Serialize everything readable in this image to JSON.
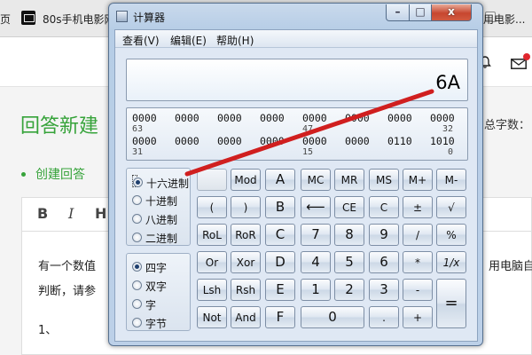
{
  "browser": {
    "tab_partial": "页",
    "tab_title": "80s手机电影网",
    "tab_right": "用电影..."
  },
  "page": {
    "answer_title": "回答新建",
    "word_count_label": "总字数：",
    "create_answer": "创建回答",
    "toolbar": {
      "bold": "B",
      "italic": "I",
      "heading": "H"
    },
    "editor_line1_left": "有一个数值",
    "editor_line1_right": "用电脑自",
    "editor_line2": "判断，请参",
    "editor_line3": "1、"
  },
  "calculator": {
    "title": "计算器",
    "window_controls": {
      "minimize": "–",
      "maximize": "□",
      "close": "x"
    },
    "menu": [
      "查看(V)",
      "编辑(E)",
      "帮助(H)"
    ],
    "display": "6A",
    "bits": {
      "row1": [
        "0000",
        "0000",
        "0000",
        "0000",
        "0000",
        "0000",
        "0000",
        "0000"
      ],
      "row1_positions": [
        "63",
        "47",
        "32"
      ],
      "row2": [
        "0000",
        "0000",
        "0000",
        "0000",
        "0000",
        "0000",
        "0110",
        "1010"
      ],
      "row2_positions": [
        "31",
        "15",
        "0"
      ]
    },
    "base_options": [
      {
        "label": "十六进制",
        "selected": true
      },
      {
        "label": "十进制",
        "selected": false
      },
      {
        "label": "八进制",
        "selected": false
      },
      {
        "label": "二进制",
        "selected": false
      }
    ],
    "word_options": [
      {
        "label": "四字",
        "selected": true
      },
      {
        "label": "双字",
        "selected": false
      },
      {
        "label": "字",
        "selected": false
      },
      {
        "label": "字节",
        "selected": false
      }
    ],
    "buttons": {
      "mod": "Mod",
      "a": "A",
      "mc": "MC",
      "mr": "MR",
      "ms": "MS",
      "mplus": "M+",
      "mminus": "M-",
      "lparen": "(",
      "rparen": ")",
      "b": "B",
      "backspace": "⟵",
      "ce": "CE",
      "c": "C",
      "plusminus": "±",
      "sqrt": "√",
      "rol": "RoL",
      "ror": "RoR",
      "c_hex": "C",
      "n7": "7",
      "n8": "8",
      "n9": "9",
      "divide": "/",
      "percent": "%",
      "or": "Or",
      "xor": "Xor",
      "d": "D",
      "n4": "4",
      "n5": "5",
      "n6": "6",
      "multiply": "*",
      "reciprocal": "1/x",
      "lsh": "Lsh",
      "rsh": "Rsh",
      "e": "E",
      "n1": "1",
      "n2": "2",
      "n3": "3",
      "minus": "-",
      "equals": "=",
      "not": "Not",
      "and": "And",
      "f": "F",
      "n0": "0",
      "dot": ".",
      "plus": "+"
    }
  },
  "annotation_color": "#d01f1f"
}
